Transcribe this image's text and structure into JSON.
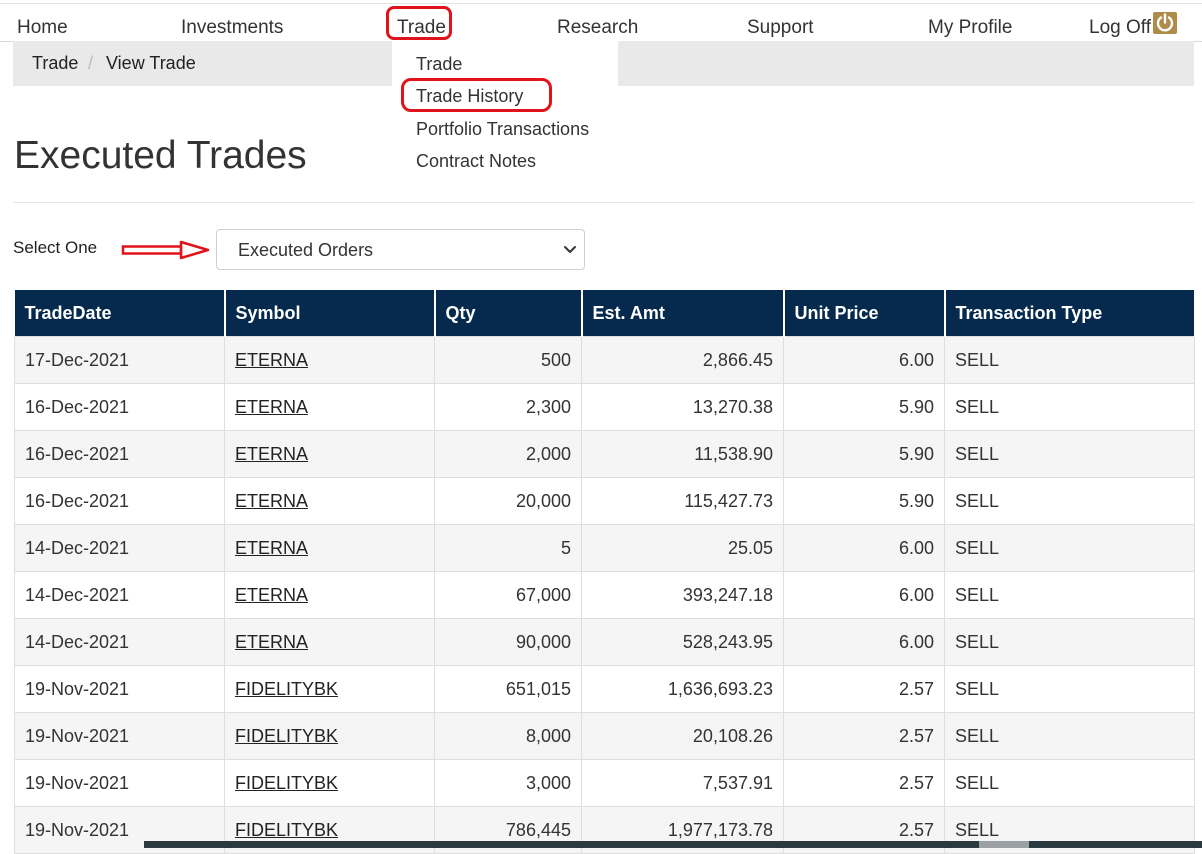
{
  "nav": {
    "items": [
      "Home",
      "Investments",
      "Trade",
      "Research",
      "Support",
      "My Profile",
      "Log Off"
    ],
    "power_icon": "power-icon",
    "accent_color": "#b08c4a"
  },
  "breadcrumb": {
    "items": [
      "Trade",
      "View Trade"
    ],
    "separator": "/"
  },
  "dropdown": {
    "items": [
      "Trade",
      "Trade History",
      "Portfolio Transactions",
      "Contract Notes"
    ]
  },
  "page": {
    "title": "Executed Trades"
  },
  "filter": {
    "label": "Select One",
    "selected": "Executed Orders"
  },
  "table": {
    "header_color": "#052a4e",
    "columns": [
      "TradeDate",
      "Symbol",
      "Qty",
      "Est. Amt",
      "Unit Price",
      "Transaction Type"
    ],
    "rows": [
      [
        "17-Dec-2021",
        "ETERNA",
        "500",
        "2,866.45",
        "6.00",
        "SELL"
      ],
      [
        "16-Dec-2021",
        "ETERNA",
        "2,300",
        "13,270.38",
        "5.90",
        "SELL"
      ],
      [
        "16-Dec-2021",
        "ETERNA",
        "2,000",
        "11,538.90",
        "5.90",
        "SELL"
      ],
      [
        "16-Dec-2021",
        "ETERNA",
        "20,000",
        "115,427.73",
        "5.90",
        "SELL"
      ],
      [
        "14-Dec-2021",
        "ETERNA",
        "5",
        "25.05",
        "6.00",
        "SELL"
      ],
      [
        "14-Dec-2021",
        "ETERNA",
        "67,000",
        "393,247.18",
        "6.00",
        "SELL"
      ],
      [
        "14-Dec-2021",
        "ETERNA",
        "90,000",
        "528,243.95",
        "6.00",
        "SELL"
      ],
      [
        "19-Nov-2021",
        "FIDELITYBK",
        "651,015",
        "1,636,693.23",
        "2.57",
        "SELL"
      ],
      [
        "19-Nov-2021",
        "FIDELITYBK",
        "8,000",
        "20,108.26",
        "2.57",
        "SELL"
      ],
      [
        "19-Nov-2021",
        "FIDELITYBK",
        "3,000",
        "7,537.91",
        "2.57",
        "SELL"
      ],
      [
        "19-Nov-2021",
        "FIDELITYBK",
        "786,445",
        "1,977,173.78",
        "2.57",
        "SELL"
      ]
    ]
  },
  "annotation_color": "#e0121a"
}
